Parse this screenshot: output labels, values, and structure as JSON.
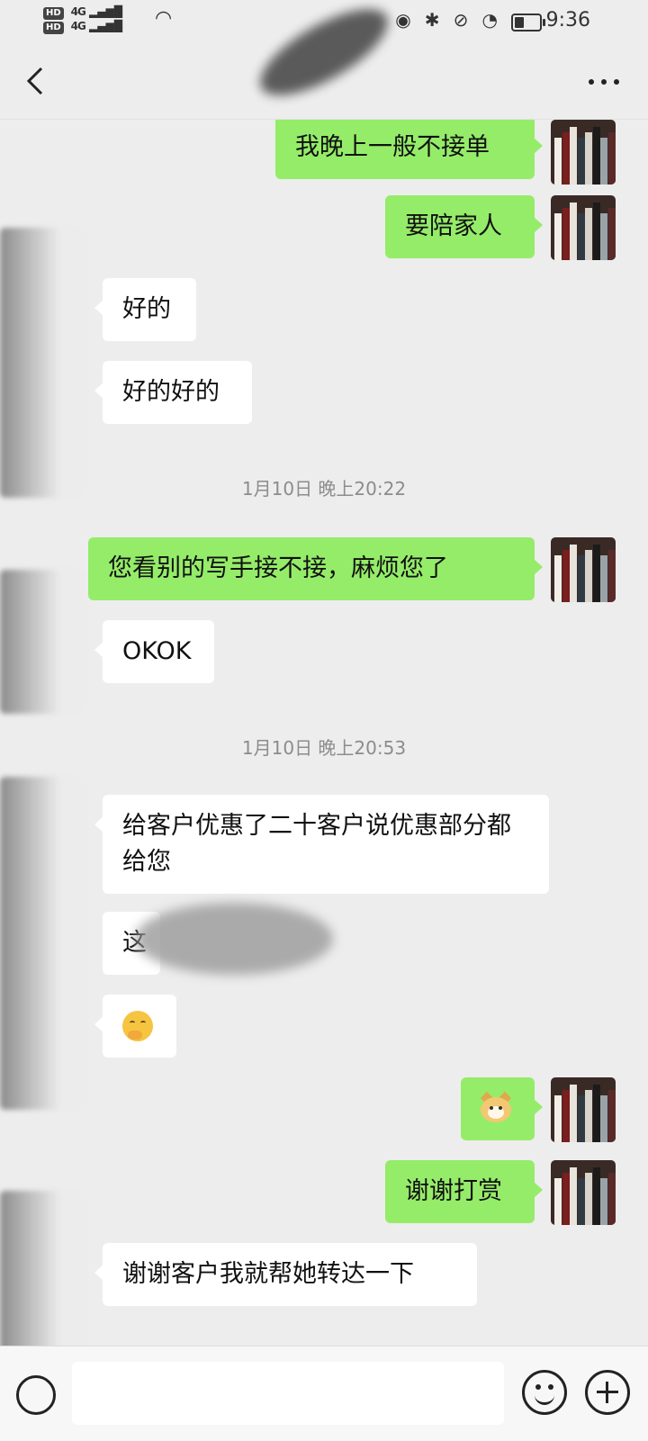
{
  "status_bar": {
    "network_1": "HD",
    "network_2": "HD",
    "signal_1": "4G",
    "signal_2": "4G",
    "time": "9:36",
    "icons": [
      "eye-icon",
      "bluetooth-icon",
      "mute-icon",
      "speed-icon",
      "battery-icon"
    ],
    "battery_level": 0.4
  },
  "nav": {
    "back_icon": "chevron-left-icon",
    "more_icon": "more-dots-icon"
  },
  "messages": [
    {
      "side": "out",
      "text": "我晚上一般不接单"
    },
    {
      "side": "out",
      "text": "要陪家人"
    },
    {
      "side": "in",
      "text": "好的"
    },
    {
      "side": "in",
      "text": "好的好的"
    },
    {
      "type": "time",
      "text": "1月10日 晚上20:22"
    },
    {
      "side": "out",
      "text": "您看别的写手接不接，麻烦您了"
    },
    {
      "side": "in",
      "text": "OKOK"
    },
    {
      "type": "time",
      "text": "1月10日 晚上20:53"
    },
    {
      "side": "in",
      "text": "给客户优惠了二十客户说优惠部分都给您"
    },
    {
      "side": "in",
      "text": "这"
    },
    {
      "side": "in",
      "emoji": "smirk-hand-emoji"
    },
    {
      "side": "out",
      "emoji": "doge-emoji"
    },
    {
      "side": "out",
      "text": "谢谢打赏"
    },
    {
      "side": "in",
      "text": "谢谢客户我就帮她转达一下"
    }
  ],
  "input": {
    "voice_icon": "voice-icon",
    "value": "",
    "emoji_icon": "emoji-icon",
    "plus_icon": "plus-icon"
  },
  "colors": {
    "background": "#ededed",
    "outgoing_bubble": "#95ec69",
    "incoming_bubble": "#ffffff",
    "timestamp": "#8c8c8c"
  }
}
